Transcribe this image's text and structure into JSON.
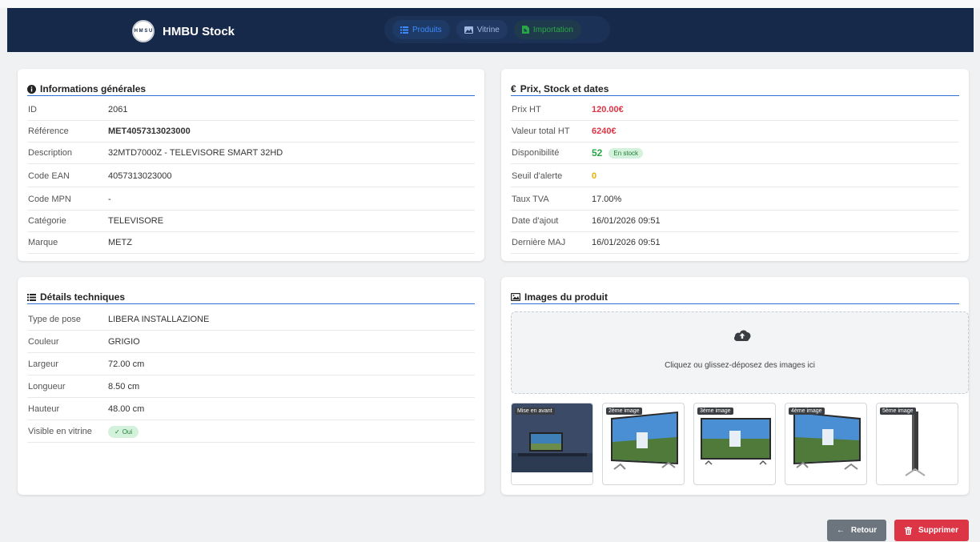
{
  "app": {
    "brand_name": "HMBU Stock",
    "logo_text": "H M S U"
  },
  "nav": {
    "tabs": [
      {
        "label": "Produits"
      },
      {
        "label": "Vitrine"
      },
      {
        "label": "Importation"
      }
    ]
  },
  "general": {
    "title": "Informations générales",
    "rows": [
      {
        "label": "ID",
        "value": "2061"
      },
      {
        "label": "Référence",
        "value": "MET4057313023000"
      },
      {
        "label": "Description",
        "value": "32MTD7000Z - TELEVISORE SMART 32HD"
      },
      {
        "label": "Code EAN",
        "value": "4057313023000"
      },
      {
        "label": "Code MPN",
        "value": "-"
      },
      {
        "label": "Catégorie",
        "value": "TELEVISORE"
      },
      {
        "label": "Marque",
        "value": "METZ"
      }
    ]
  },
  "pricing": {
    "title": "Prix, Stock et dates",
    "rows": [
      {
        "label": "Prix HT",
        "value": "120.00€"
      },
      {
        "label": "Valeur total HT",
        "value": "6240€"
      },
      {
        "label": "Disponibilité",
        "value": "52",
        "badge": "En stock"
      },
      {
        "label": "Seuil d'alerte",
        "value": "0"
      },
      {
        "label": "Taux TVA",
        "value": "17.00%"
      },
      {
        "label": "Date d'ajout",
        "value": "16/01/2026 09:51"
      },
      {
        "label": "Dernière MAJ",
        "value": "16/01/2026 09:51"
      }
    ]
  },
  "technical": {
    "title": "Détails techniques",
    "rows": [
      {
        "label": "Type de pose",
        "value": "LIBERA INSTALLAZIONE"
      },
      {
        "label": "Couleur",
        "value": "GRIGIO"
      },
      {
        "label": "Largeur",
        "value": "72.00 cm"
      },
      {
        "label": "Longueur",
        "value": "8.50 cm"
      },
      {
        "label": "Hauteur",
        "value": "48.00 cm"
      },
      {
        "label": "Visible en vitrine",
        "value": "Oui"
      }
    ]
  },
  "images": {
    "title": "Images du produit",
    "drop_text": "Cliquez ou glissez-déposez des images ici",
    "thumbs": [
      {
        "tag": "Mise en avant"
      },
      {
        "tag": "2ème image"
      },
      {
        "tag": "3ème image"
      },
      {
        "tag": "4ème image"
      },
      {
        "tag": "5ème image"
      }
    ]
  },
  "actions": {
    "back_label": "Retour",
    "delete_label": "Supprimer"
  },
  "colors": {
    "navbar": "#17294a",
    "accent": "#2d6fd6",
    "danger": "#dc3545",
    "success": "#28a745",
    "warning": "#f0ad00"
  }
}
